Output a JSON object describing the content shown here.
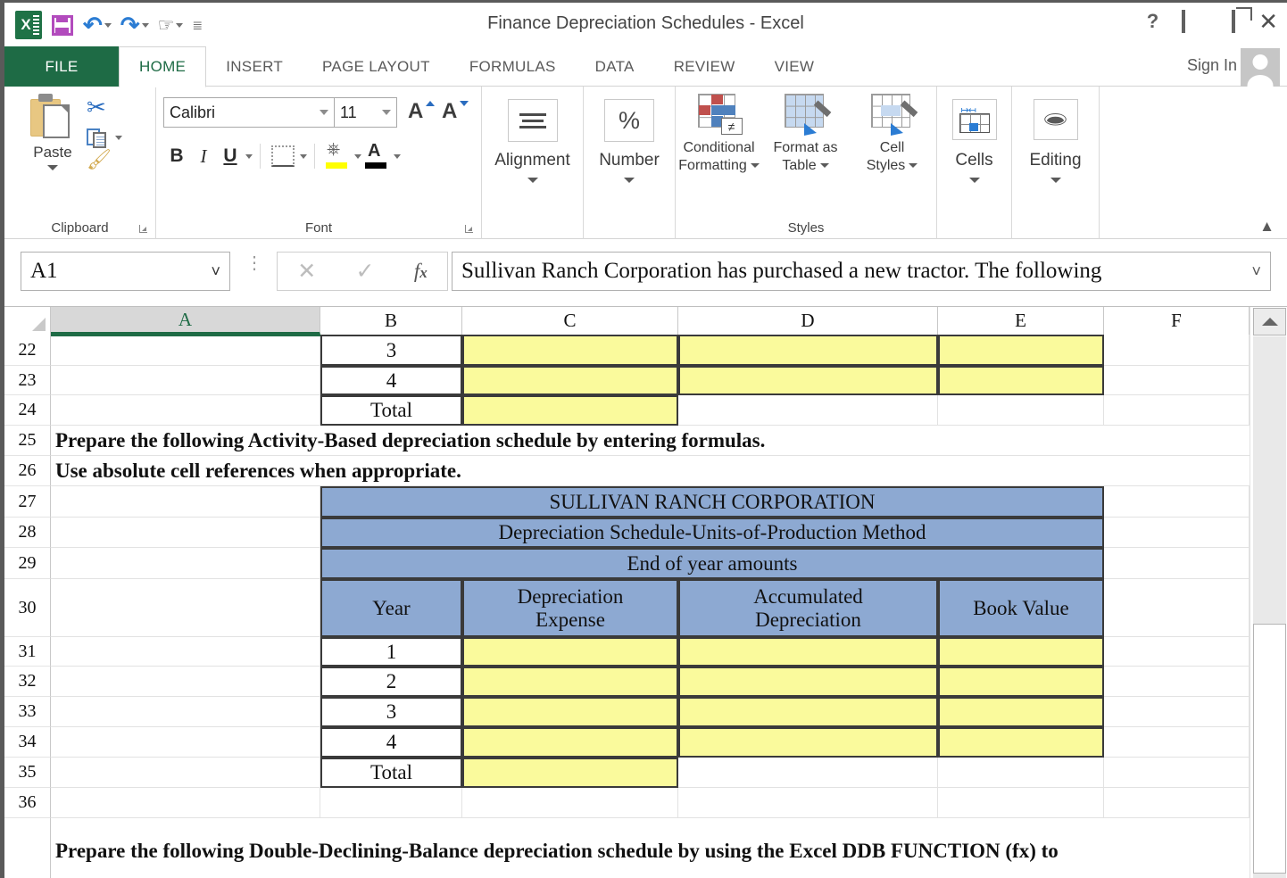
{
  "window": {
    "title": "Finance Depreciation Schedules - Excel",
    "quick_access": [
      {
        "name": "excel-logo-icon",
        "label": "X"
      },
      {
        "name": "save-icon",
        "label": "Save"
      },
      {
        "name": "undo-icon",
        "label": "Undo"
      },
      {
        "name": "redo-icon",
        "label": "Redo"
      },
      {
        "name": "touch-mode-icon",
        "label": "Touch/Mouse Mode"
      },
      {
        "name": "customize-quick-access-icon",
        "label": "Customize Quick Access Toolbar"
      }
    ],
    "controls": {
      "help": "?",
      "ribbon_display": "Ribbon Display Options",
      "minimize": "Minimize",
      "restore": "Restore Down",
      "close": "Close"
    }
  },
  "ribbon": {
    "tabs": [
      {
        "label": "FILE",
        "active": false
      },
      {
        "label": "HOME",
        "active": true
      },
      {
        "label": "INSERT",
        "active": false
      },
      {
        "label": "PAGE LAYOUT",
        "active": false
      },
      {
        "label": "FORMULAS",
        "active": false
      },
      {
        "label": "DATA",
        "active": false
      },
      {
        "label": "REVIEW",
        "active": false
      },
      {
        "label": "VIEW",
        "active": false
      }
    ],
    "sign_in": "Sign In",
    "groups": {
      "clipboard": {
        "label": "Clipboard",
        "paste": "Paste",
        "cut": "Cut",
        "copy": "Copy",
        "format_painter": "Format Painter"
      },
      "font": {
        "label": "Font",
        "font_name": "Calibri",
        "font_size": "11",
        "grow_font": "A",
        "shrink_font": "A",
        "bold": "B",
        "italic": "I",
        "underline": "U",
        "borders": "Borders",
        "fill_color": "Fill Color",
        "font_color": "A",
        "fill_swatch": "#ffff00",
        "font_color_swatch": "#000000"
      },
      "alignment": {
        "label": "Alignment"
      },
      "number": {
        "label": "Number",
        "symbol": "%"
      },
      "styles": {
        "label": "Styles",
        "conditional_formatting": "Conditional\nFormatting",
        "conditional_formatting_l1": "Conditional",
        "conditional_formatting_l2": "Formatting",
        "format_as_table_l1": "Format as",
        "format_as_table_l2": "Table",
        "cell_styles_l1": "Cell",
        "cell_styles_l2": "Styles",
        "neq_symbol": "≠"
      },
      "cells": {
        "label": "Cells"
      },
      "editing": {
        "label": "Editing"
      }
    }
  },
  "formula_bar": {
    "name_box": "A1",
    "cancel": "✕",
    "enter": "✓",
    "insert_function": "fx",
    "value": "Sullivan Ranch Corporation has purchased a new tractor.  The following"
  },
  "sheet": {
    "columns": [
      {
        "label": "A",
        "selected": true
      },
      {
        "label": "B",
        "selected": false
      },
      {
        "label": "C",
        "selected": false
      },
      {
        "label": "D",
        "selected": false
      },
      {
        "label": "E",
        "selected": false
      },
      {
        "label": "F",
        "selected": false
      }
    ],
    "rows": [
      "22",
      "23",
      "24",
      "25",
      "26",
      "27",
      "28",
      "29",
      "30",
      "31",
      "32",
      "33",
      "34",
      "35",
      "36"
    ],
    "cells": {
      "b22": "3",
      "b23": "4",
      "b24": "Total",
      "a25": "Prepare the following Activity-Based depreciation schedule by entering formulas.",
      "a26": "Use absolute cell references when appropriate.",
      "b27": "SULLIVAN RANCH CORPORATION",
      "b28": "Depreciation Schedule-Units-of-Production Method",
      "b29": "End of year amounts",
      "b30": "Year",
      "c30_l1": "Depreciation",
      "c30_l2": "Expense",
      "d30_l1": "Accumulated",
      "d30_l2": "Depreciation",
      "e30": "Book Value",
      "b31": "1",
      "b32": "2",
      "b33": "3",
      "b34": "4",
      "b35": "Total",
      "a37": "Prepare the following Double-Declining-Balance depreciation schedule by using the Excel DDB FUNCTION (fx) to"
    },
    "colors": {
      "input_yellow": "#fafa9c",
      "header_blue": "#8da9d2",
      "selection_green": "#1e6b45",
      "cell_border": "#3a3a3a"
    }
  },
  "scrollbar": {
    "up_arrow": "▲"
  }
}
